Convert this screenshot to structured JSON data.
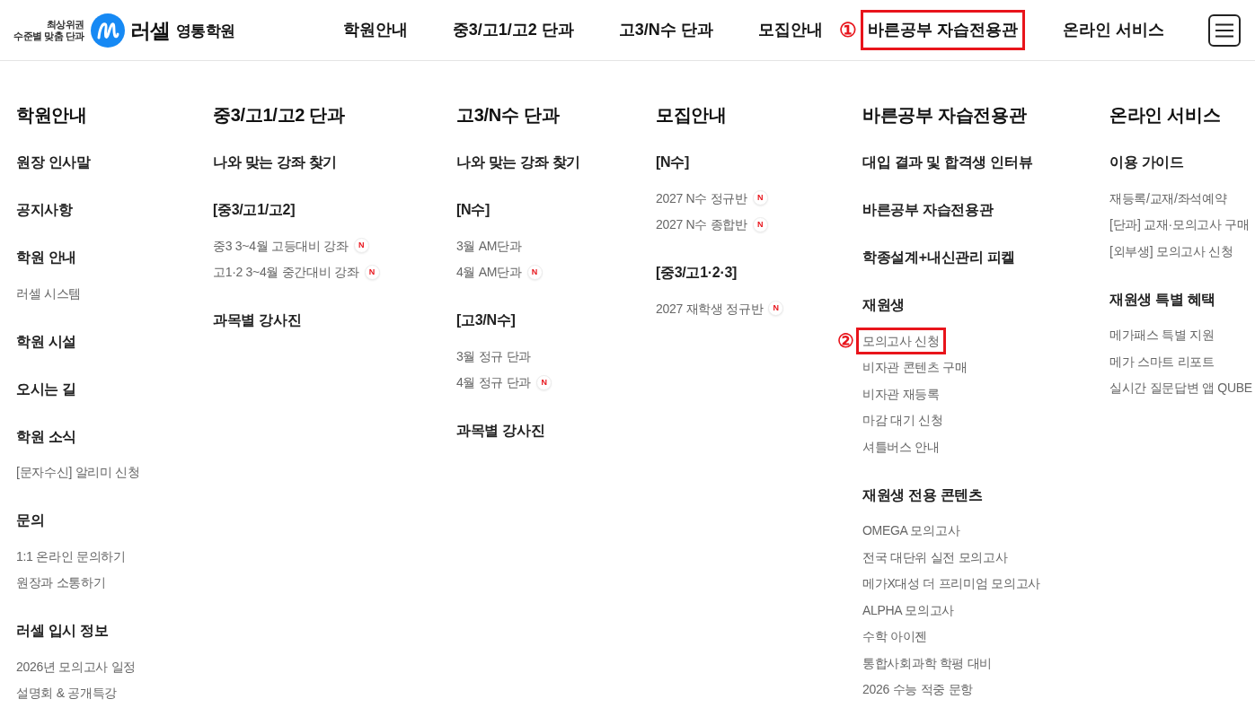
{
  "header": {
    "logo": {
      "tagline": [
        "최상위권",
        "수준별 맞춤 단과"
      ],
      "name": "러셀",
      "branch": "영통학원"
    },
    "nav": [
      {
        "label": "학원안내",
        "highlighted": false
      },
      {
        "label": "중3/고1/고2 단과",
        "highlighted": false
      },
      {
        "label": "고3/N수 단과",
        "highlighted": false
      },
      {
        "label": "모집안내",
        "highlighted": false
      },
      {
        "label": "바른공부 자습전용관",
        "highlighted": true,
        "marker": "①"
      },
      {
        "label": "온라인 서비스",
        "highlighted": false
      }
    ]
  },
  "mega_menu": {
    "columns": [
      {
        "title": "학원안내",
        "groups": [
          {
            "heading": "원장 인사말"
          },
          {
            "heading": "공지사항"
          },
          {
            "heading": "학원 안내",
            "links": [
              {
                "label": "러셀 시스템",
                "highlighted": false
              }
            ]
          },
          {
            "heading": "학원 시설"
          },
          {
            "heading": "오시는 길"
          },
          {
            "heading": "학원 소식",
            "links": [
              {
                "label": "[문자수신] 알리미 신청",
                "highlighted": false
              }
            ]
          },
          {
            "heading": "문의",
            "links": [
              {
                "label": "1:1 온라인 문의하기",
                "highlighted": false
              },
              {
                "label": "원장과 소통하기",
                "highlighted": false
              }
            ]
          },
          {
            "heading": "러셀 입시 정보",
            "links": [
              {
                "label": "2026년 모의고사 일정",
                "highlighted": false
              },
              {
                "label": "설명회 & 공개특강",
                "highlighted": false
              }
            ]
          }
        ]
      },
      {
        "title": "중3/고1/고2 단과",
        "groups": [
          {
            "heading": "나와 맞는 강좌 찾기"
          },
          {
            "heading": "[중3/고1/고2]",
            "links": [
              {
                "label": "중3 3~4월 고등대비 강좌",
                "highlighted": false,
                "badge": "N"
              },
              {
                "label": "고1·2 3~4월 중간대비 강좌",
                "highlighted": false,
                "badge": "N"
              }
            ]
          },
          {
            "heading": "과목별 강사진"
          }
        ]
      },
      {
        "title": "고3/N수 단과",
        "groups": [
          {
            "heading": "나와 맞는 강좌 찾기"
          },
          {
            "heading": "[N수]",
            "links": [
              {
                "label": "3월 AM단과",
                "highlighted": false
              },
              {
                "label": "4월 AM단과",
                "highlighted": false,
                "badge": "N"
              }
            ]
          },
          {
            "heading": "[고3/N수]",
            "links": [
              {
                "label": "3월 정규 단과",
                "highlighted": false
              },
              {
                "label": "4월 정규 단과",
                "highlighted": false,
                "badge": "N"
              }
            ]
          },
          {
            "heading": "과목별 강사진"
          }
        ]
      },
      {
        "title": "모집안내",
        "groups": [
          {
            "heading": "[N수]",
            "links": [
              {
                "label": "2027 N수 정규반",
                "highlighted": false,
                "badge": "N"
              },
              {
                "label": "2027 N수 종합반",
                "highlighted": false,
                "badge": "N"
              }
            ]
          },
          {
            "heading": "[중3/고1·2·3]",
            "links": [
              {
                "label": "2027 재학생 정규반",
                "highlighted": false,
                "badge": "N"
              }
            ]
          }
        ]
      },
      {
        "title": "바른공부 자습전용관",
        "groups": [
          {
            "heading": "대입 결과 및 합격생 인터뷰"
          },
          {
            "heading": "바른공부 자습전용관"
          },
          {
            "heading": "학종설계+내신관리 피켈"
          },
          {
            "heading": "재원생",
            "links": [
              {
                "label": "모의고사 신청",
                "highlighted": true,
                "marker": "②"
              },
              {
                "label": "비자관 콘텐츠 구매",
                "highlighted": false
              },
              {
                "label": "비자관 재등록",
                "highlighted": false
              },
              {
                "label": "마감 대기 신청",
                "highlighted": false
              },
              {
                "label": "셔틀버스 안내",
                "highlighted": false
              }
            ]
          },
          {
            "heading": "재원생 전용 콘텐츠",
            "links": [
              {
                "label": "OMEGA 모의고사",
                "highlighted": false
              },
              {
                "label": "전국 대단위 실전 모의고사",
                "highlighted": false
              },
              {
                "label": "메가X대성 더 프리미엄 모의고사",
                "highlighted": false
              },
              {
                "label": "ALPHA 모의고사",
                "highlighted": false
              },
              {
                "label": "수학 아이젠",
                "highlighted": false
              },
              {
                "label": "통합사회과학 학평 대비",
                "highlighted": false
              },
              {
                "label": "2026 수능 적중 문항",
                "highlighted": false
              }
            ]
          }
        ]
      },
      {
        "title": "온라인 서비스",
        "groups": [
          {
            "heading": "이용 가이드",
            "links": [
              {
                "label": "재등록/교재/좌석예약",
                "highlighted": false
              },
              {
                "label": "[단과] 교재·모의고사 구매",
                "highlighted": false
              },
              {
                "label": "[외부생] 모의고사 신청",
                "highlighted": false
              }
            ]
          },
          {
            "heading": "재원생 특별 혜택",
            "links": [
              {
                "label": "메가패스 특별 지원",
                "highlighted": false
              },
              {
                "label": "메가 스마트 리포트",
                "highlighted": false
              },
              {
                "label": "실시간 질문답변 앱 QUBE",
                "highlighted": false
              }
            ]
          }
        ]
      }
    ]
  }
}
